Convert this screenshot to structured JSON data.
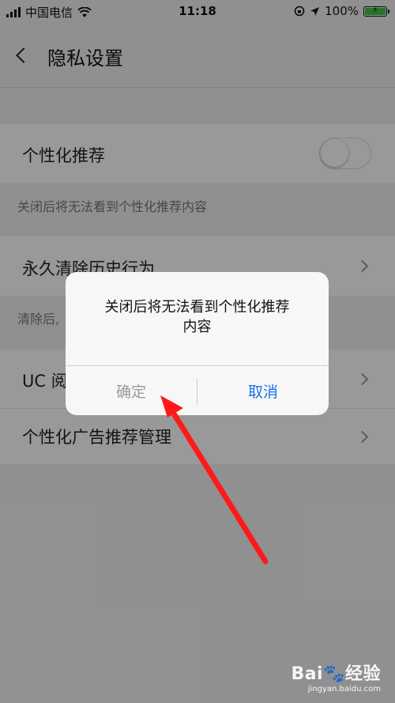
{
  "status_bar": {
    "carrier": "中国电信",
    "time": "11:18",
    "battery": "100%",
    "battery_level": 1.0
  },
  "nav": {
    "title": "隐私设置",
    "back_icon": "chevron-left-icon"
  },
  "settings": {
    "personalized_recommend": {
      "label": "个性化推荐",
      "toggle_on": false,
      "note": "关闭后将无法看到个性化推荐内容"
    },
    "clear_history": {
      "label": "永久清除历史行为",
      "note": "清除后,"
    },
    "uc_read": {
      "label": "UC 阅"
    },
    "ad_manage": {
      "label": "个性化广告推荐管理"
    }
  },
  "dialog": {
    "message": "关闭后将无法看到个性化推荐\n内容",
    "confirm_label": "确定",
    "cancel_label": "取消"
  },
  "annotation": {
    "arrow_color": "#ff1a1a"
  },
  "watermark": {
    "logo": "Bai🐾经验",
    "url": "jingyan.baidu.com"
  },
  "colors": {
    "accent": "#1a73e8",
    "toggle_off": "#ffffff",
    "disabled_text": "#9a9a9a",
    "battery_fill": "#3cc24a"
  }
}
